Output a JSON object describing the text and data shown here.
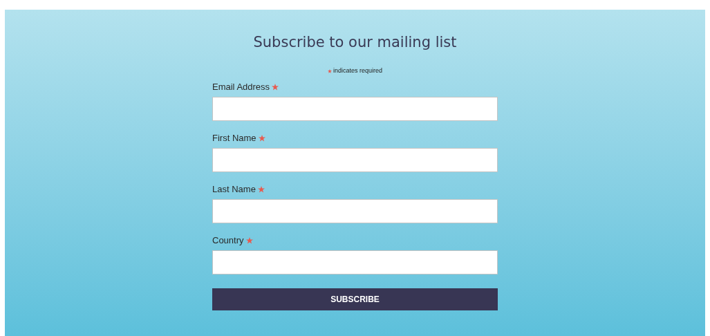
{
  "title": "Subscribe to our mailing list",
  "required_note": "indicates required",
  "fields": [
    {
      "label": "Email Address",
      "required": true
    },
    {
      "label": "First Name",
      "required": true
    },
    {
      "label": "Last Name",
      "required": true
    },
    {
      "label": "Country",
      "required": true
    }
  ],
  "submit_button": "SUBSCRIBE"
}
